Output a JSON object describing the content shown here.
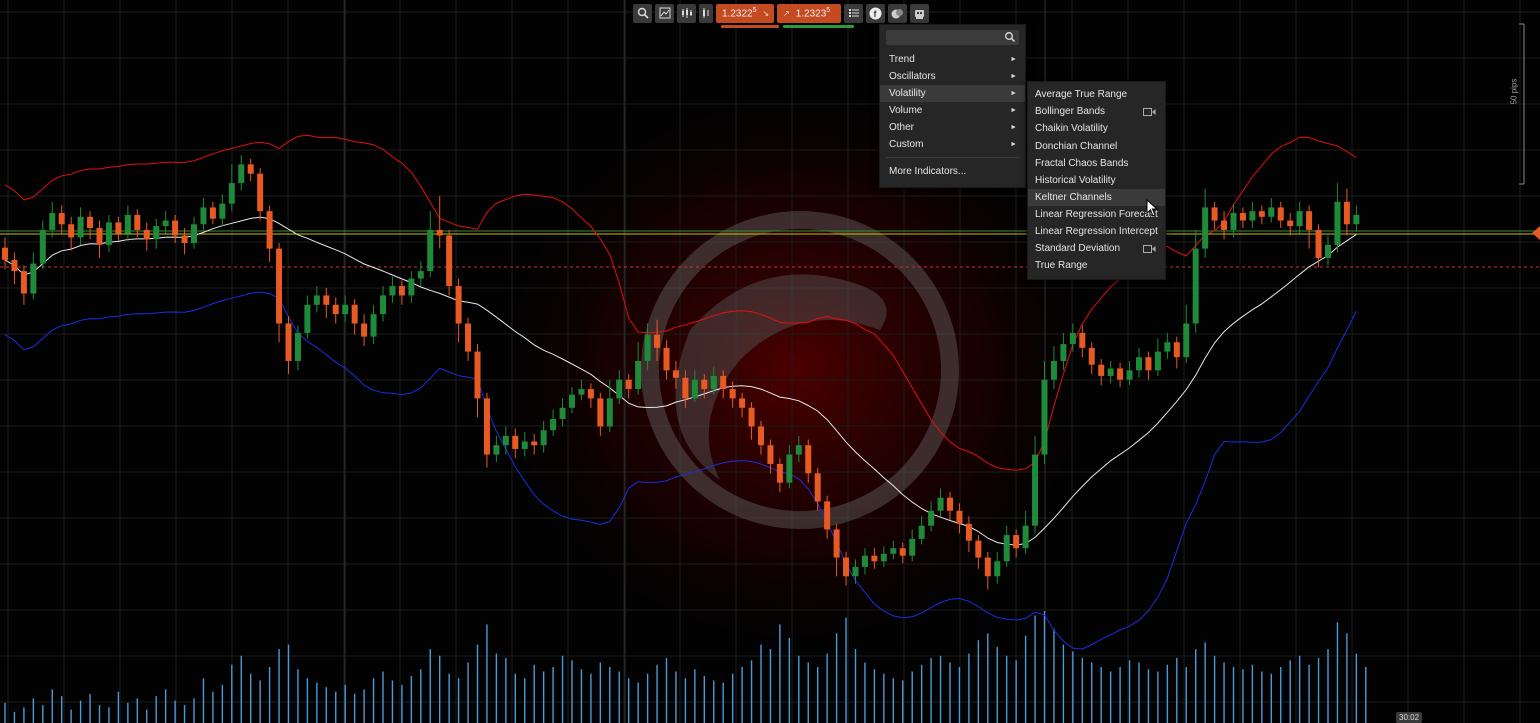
{
  "toolbar": {
    "sell_price": "1.2322",
    "sell_sup": "5",
    "buy_price": "1.2323",
    "buy_sup": "5",
    "icons": [
      "zoom-icon",
      "draw-icon",
      "indicators-icon",
      "chart-type-icon",
      "list-icon",
      "social-icon",
      "theme-icon",
      "robot-icon"
    ]
  },
  "search": {
    "placeholder": ""
  },
  "menu": {
    "items": [
      {
        "label": "Trend",
        "submenu": true
      },
      {
        "label": "Oscillators",
        "submenu": true
      },
      {
        "label": "Volatility",
        "submenu": true,
        "active": true
      },
      {
        "label": "Volume",
        "submenu": true
      },
      {
        "label": "Other",
        "submenu": true
      },
      {
        "label": "Custom",
        "submenu": true
      }
    ],
    "more_label": "More Indicators..."
  },
  "submenu": {
    "items": [
      {
        "label": "Average True Range"
      },
      {
        "label": "Bollinger Bands",
        "video": true
      },
      {
        "label": "Chaikin Volatility"
      },
      {
        "label": "Donchian Channel"
      },
      {
        "label": "Fractal Chaos Bands"
      },
      {
        "label": "Historical Volatility"
      },
      {
        "label": "Keltner Channels",
        "highlighted": true
      },
      {
        "label": "Linear Regression Forecast"
      },
      {
        "label": "Linear Regression Intercept"
      },
      {
        "label": "Standard Deviation",
        "video": true
      },
      {
        "label": "True Range"
      }
    ]
  },
  "scale_label": "50 pips",
  "time_tag": "30:02",
  "colors": {
    "bull": "#1f8a3a",
    "bear": "#e85a24",
    "upper_band": "#e01010",
    "lower_band": "#1a2ee0",
    "middle_band": "#e8e8e8",
    "volume": "#4a9ad8",
    "price_line_green": "#3c8a3c",
    "price_line_yellow": "#c8c000",
    "price_line_red": "#d03030"
  },
  "chart_data": {
    "type": "candlestick",
    "candles": [
      [
        1.23201,
        1.23188,
        1.23212,
        1.23178
      ],
      [
        1.23188,
        1.23176,
        1.23196,
        1.23162
      ],
      [
        1.23176,
        1.23152,
        1.23182,
        1.2314
      ],
      [
        1.23152,
        1.23184,
        1.23196,
        1.23146
      ],
      [
        1.23184,
        1.2322,
        1.2323,
        1.23178
      ],
      [
        1.2322,
        1.23238,
        1.2325,
        1.23212
      ],
      [
        1.23238,
        1.23226,
        1.23246,
        1.23216
      ],
      [
        1.23226,
        1.23212,
        1.23234,
        1.23198
      ],
      [
        1.23212,
        1.23234,
        1.23244,
        1.23204
      ],
      [
        1.23234,
        1.23222,
        1.2324,
        1.2321
      ],
      [
        1.23222,
        1.23204,
        1.2323,
        1.2319
      ],
      [
        1.23204,
        1.23228,
        1.23236,
        1.23196
      ],
      [
        1.23228,
        1.23216,
        1.23234,
        1.23208
      ],
      [
        1.23216,
        1.23236,
        1.23246,
        1.23208
      ],
      [
        1.23236,
        1.2322,
        1.23242,
        1.23212
      ],
      [
        1.2322,
        1.2321,
        1.23228,
        1.23198
      ],
      [
        1.2321,
        1.23224,
        1.23232,
        1.232
      ],
      [
        1.23224,
        1.2323,
        1.2324,
        1.23216
      ],
      [
        1.2323,
        1.23214,
        1.23236,
        1.23206
      ],
      [
        1.23214,
        1.23206,
        1.23222,
        1.23194
      ],
      [
        1.23206,
        1.23226,
        1.23234,
        1.232
      ],
      [
        1.23226,
        1.23244,
        1.23254,
        1.2322
      ],
      [
        1.23244,
        1.23232,
        1.2325,
        1.23226
      ],
      [
        1.23232,
        1.23248,
        1.23258,
        1.23224
      ],
      [
        1.23248,
        1.2327,
        1.2329,
        1.2324
      ],
      [
        1.2327,
        1.2329,
        1.233,
        1.23262
      ],
      [
        1.2329,
        1.2328,
        1.23296,
        1.23272
      ],
      [
        1.2328,
        1.2324,
        1.23286,
        1.2323
      ],
      [
        1.2324,
        1.232,
        1.23246,
        1.23186
      ],
      [
        1.232,
        1.2312,
        1.23206,
        1.231
      ],
      [
        1.2312,
        1.2308,
        1.23128,
        1.23066
      ],
      [
        1.2308,
        1.2311,
        1.23118,
        1.2307
      ],
      [
        1.2311,
        1.2314,
        1.2315,
        1.23104
      ],
      [
        1.2314,
        1.2315,
        1.2316,
        1.23132
      ],
      [
        1.2315,
        1.2314,
        1.23158,
        1.23126
      ],
      [
        1.2314,
        1.2313,
        1.23148,
        1.2312
      ],
      [
        1.2313,
        1.2314,
        1.2315,
        1.23122
      ],
      [
        1.2314,
        1.2312,
        1.23146,
        1.23108
      ],
      [
        1.2312,
        1.23106,
        1.2313,
        1.23096
      ],
      [
        1.23106,
        1.2313,
        1.2314,
        1.23098
      ],
      [
        1.2313,
        1.2315,
        1.2316,
        1.23122
      ],
      [
        1.2315,
        1.2316,
        1.2317,
        1.23142
      ],
      [
        1.2316,
        1.2315,
        1.23166,
        1.2314
      ],
      [
        1.2315,
        1.23168,
        1.23176,
        1.23142
      ],
      [
        1.23168,
        1.23176,
        1.23186,
        1.2316
      ],
      [
        1.23176,
        1.2322,
        1.2324,
        1.2317
      ],
      [
        1.2322,
        1.23214,
        1.23256,
        1.232
      ],
      [
        1.23214,
        1.2316,
        1.2322,
        1.2315
      ],
      [
        1.2316,
        1.2312,
        1.23168,
        1.231
      ],
      [
        1.2312,
        1.2309,
        1.23126,
        1.2308
      ],
      [
        1.2309,
        1.2304,
        1.23098,
        1.2302
      ],
      [
        1.2304,
        1.2298,
        1.23046,
        1.22966
      ],
      [
        1.2298,
        1.2299,
        1.23,
        1.22972
      ],
      [
        1.2299,
        1.23,
        1.2301,
        1.2298
      ],
      [
        1.23,
        1.22986,
        1.23008,
        1.22976
      ],
      [
        1.22986,
        1.22994,
        1.23004,
        1.22978
      ],
      [
        1.22994,
        1.2299,
        1.23002,
        1.2298
      ],
      [
        1.2299,
        1.23006,
        1.23016,
        1.22982
      ],
      [
        1.23006,
        1.23018,
        1.23028,
        1.23
      ],
      [
        1.23018,
        1.2303,
        1.2304,
        1.2301
      ],
      [
        1.2303,
        1.23044,
        1.23052,
        1.23024
      ],
      [
        1.23044,
        1.2305,
        1.2306,
        1.23038
      ],
      [
        1.2305,
        1.2304,
        1.23056,
        1.2303
      ],
      [
        1.2304,
        1.2301,
        1.23046,
        1.23
      ],
      [
        1.2301,
        1.2304,
        1.2306,
        1.23004
      ],
      [
        1.2304,
        1.2306,
        1.2307,
        1.23034
      ],
      [
        1.2306,
        1.2305,
        1.23066,
        1.2304
      ],
      [
        1.2305,
        1.2308,
        1.231,
        1.23044
      ],
      [
        1.2308,
        1.23108,
        1.2312,
        1.2307
      ],
      [
        1.23108,
        1.23094,
        1.23124,
        1.2308
      ],
      [
        1.23094,
        1.2307,
        1.23102,
        1.2306
      ],
      [
        1.2307,
        1.23062,
        1.2308,
        1.2305
      ],
      [
        1.23062,
        1.2304,
        1.2307,
        1.2303
      ],
      [
        1.2304,
        1.2306,
        1.2307,
        1.23036
      ],
      [
        1.2306,
        1.2305,
        1.23066,
        1.2304
      ],
      [
        1.2305,
        1.23064,
        1.23074,
        1.23044
      ],
      [
        1.23064,
        1.2305,
        1.2307,
        1.2304
      ],
      [
        1.2305,
        1.2304,
        1.23058,
        1.2303
      ],
      [
        1.2304,
        1.2303,
        1.23046,
        1.2302
      ],
      [
        1.2303,
        1.2301,
        1.23036,
        1.22996
      ],
      [
        1.2301,
        1.2299,
        1.23016,
        1.2298
      ],
      [
        1.2299,
        1.2297,
        1.22996,
        1.2296
      ],
      [
        1.2297,
        1.2295,
        1.22976,
        1.2294
      ],
      [
        1.2295,
        1.2298,
        1.2299,
        1.22944
      ],
      [
        1.2298,
        1.2299,
        1.23,
        1.22972
      ],
      [
        1.2299,
        1.2296,
        1.22996,
        1.2295
      ],
      [
        1.2296,
        1.2293,
        1.22966,
        1.2292
      ],
      [
        1.2293,
        1.229,
        1.22936,
        1.2289
      ],
      [
        1.229,
        1.2287,
        1.22906,
        1.2285
      ],
      [
        1.2287,
        1.2285,
        1.22876,
        1.2284
      ],
      [
        1.2285,
        1.2286,
        1.22868,
        1.22842
      ],
      [
        1.2286,
        1.22872,
        1.2288,
        1.22852
      ],
      [
        1.22872,
        1.22866,
        1.2288,
        1.22858
      ],
      [
        1.22866,
        1.22874,
        1.22882,
        1.2286
      ],
      [
        1.22874,
        1.2288,
        1.22888,
        1.22868
      ],
      [
        1.2288,
        1.22872,
        1.22886,
        1.22864
      ],
      [
        1.22872,
        1.2289,
        1.229,
        1.22866
      ],
      [
        1.2289,
        1.22904,
        1.22914,
        1.22884
      ],
      [
        1.22904,
        1.2292,
        1.2293,
        1.22898
      ],
      [
        1.2292,
        1.22934,
        1.22944,
        1.22914
      ],
      [
        1.22934,
        1.2292,
        1.2294,
        1.2291
      ],
      [
        1.2292,
        1.22906,
        1.22928,
        1.22896
      ],
      [
        1.22906,
        1.22888,
        1.22914,
        1.22876
      ],
      [
        1.22888,
        1.2287,
        1.22894,
        1.22858
      ],
      [
        1.2287,
        1.2285,
        1.22876,
        1.22836
      ],
      [
        1.2285,
        1.22866,
        1.22876,
        1.22842
      ],
      [
        1.22866,
        1.22894,
        1.22904,
        1.2286
      ],
      [
        1.22894,
        1.2288,
        1.229,
        1.2287
      ],
      [
        1.2288,
        1.22904,
        1.2292,
        1.22874
      ],
      [
        1.22904,
        1.2298,
        1.23,
        1.22896
      ],
      [
        1.2298,
        1.2306,
        1.2308,
        1.2297
      ],
      [
        1.2306,
        1.2308,
        1.23096,
        1.2305
      ],
      [
        1.2308,
        1.23098,
        1.2311,
        1.2307
      ],
      [
        1.23098,
        1.2311,
        1.2312,
        1.2309
      ],
      [
        1.2311,
        1.23094,
        1.23118,
        1.23084
      ],
      [
        1.23094,
        1.23076,
        1.231,
        1.23066
      ],
      [
        1.23076,
        1.23064,
        1.23082,
        1.23054
      ],
      [
        1.23064,
        1.23072,
        1.2308,
        1.23056
      ],
      [
        1.23072,
        1.2306,
        1.23078,
        1.23052
      ],
      [
        1.2306,
        1.2307,
        1.2308,
        1.23054
      ],
      [
        1.2307,
        1.23084,
        1.23094,
        1.23062
      ],
      [
        1.23084,
        1.2307,
        1.2309,
        1.2306
      ],
      [
        1.2307,
        1.2309,
        1.23104,
        1.23064
      ],
      [
        1.2309,
        1.231,
        1.2311,
        1.23082
      ],
      [
        1.231,
        1.23084,
        1.23106,
        1.23072
      ],
      [
        1.23084,
        1.2312,
        1.2314,
        1.23078
      ],
      [
        1.2312,
        1.232,
        1.2322,
        1.2311
      ],
      [
        1.232,
        1.23244,
        1.23264,
        1.2319
      ],
      [
        1.23244,
        1.2323,
        1.2325,
        1.2322
      ],
      [
        1.2323,
        1.2322,
        1.2324,
        1.2321
      ],
      [
        1.2322,
        1.23238,
        1.23248,
        1.23212
      ],
      [
        1.23238,
        1.2323,
        1.23244,
        1.23222
      ],
      [
        1.2323,
        1.2324,
        1.2325,
        1.23222
      ],
      [
        1.2324,
        1.23234,
        1.23246,
        1.23226
      ],
      [
        1.23234,
        1.23244,
        1.23254,
        1.23228
      ],
      [
        1.23244,
        1.2323,
        1.2325,
        1.23222
      ],
      [
        1.2323,
        1.23224,
        1.23238,
        1.23214
      ],
      [
        1.23224,
        1.2324,
        1.2325,
        1.23216
      ],
      [
        1.2324,
        1.2322,
        1.23246,
        1.232
      ],
      [
        1.2322,
        1.2319,
        1.23226,
        1.2318
      ],
      [
        1.2319,
        1.23204,
        1.23214,
        1.23182
      ],
      [
        1.23204,
        1.2325,
        1.2327,
        1.23196
      ],
      [
        1.2325,
        1.23226,
        1.23264,
        1.23214
      ],
      [
        1.23226,
        1.23236,
        1.23246,
        1.23218
      ]
    ],
    "volume": [
      18,
      10,
      14,
      22,
      16,
      30,
      24,
      12,
      20,
      26,
      16,
      14,
      28,
      18,
      22,
      12,
      24,
      30,
      20,
      16,
      22,
      40,
      28,
      34,
      52,
      60,
      44,
      38,
      50,
      66,
      70,
      48,
      40,
      36,
      32,
      28,
      34,
      26,
      30,
      40,
      46,
      38,
      34,
      42,
      48,
      66,
      60,
      44,
      40,
      54,
      70,
      88,
      62,
      58,
      44,
      40,
      52,
      46,
      50,
      60,
      56,
      48,
      44,
      54,
      50,
      46,
      40,
      36,
      44,
      52,
      58,
      46,
      40,
      48,
      42,
      38,
      36,
      44,
      50,
      56,
      70,
      66,
      88,
      76,
      60,
      54,
      50,
      62,
      80,
      94,
      66,
      54,
      48,
      44,
      40,
      38,
      46,
      52,
      58,
      60,
      54,
      50,
      62,
      74,
      80,
      68,
      60,
      56,
      78,
      96,
      100,
      84,
      70,
      64,
      58,
      54,
      50,
      46,
      50,
      56,
      54,
      48,
      46,
      52,
      58,
      50,
      66,
      72,
      60,
      54,
      50,
      48,
      52,
      46,
      44,
      50,
      56,
      60,
      52,
      58,
      66,
      90,
      80,
      62,
      50
    ],
    "upper_band_note": "red line",
    "lower_band_note": "blue line"
  }
}
